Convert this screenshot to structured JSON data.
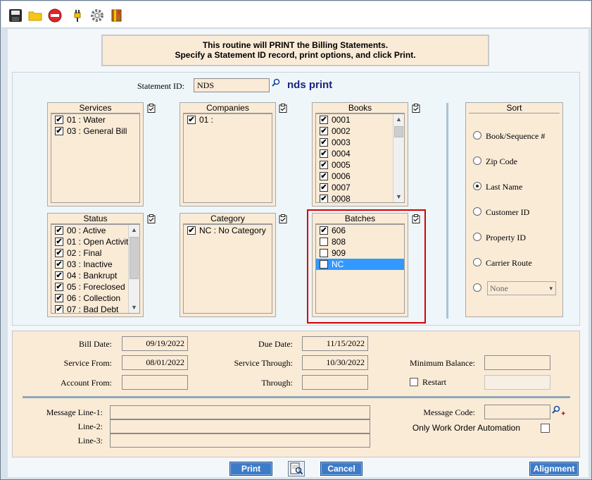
{
  "toolbar": {
    "icons": [
      "save-icon",
      "open-folder-icon",
      "stop-icon",
      "plug-icon",
      "gear-icon",
      "book-icon"
    ]
  },
  "banner": {
    "line1": "This routine will PRINT the Billing Statements.",
    "line2": "Specify a Statement ID record, print options, and click Print."
  },
  "statement": {
    "label": "Statement ID:",
    "value": "NDS",
    "name": "nds print"
  },
  "services": {
    "title": "Services",
    "items": [
      {
        "label": "01 : Water",
        "checked": "✔"
      },
      {
        "label": "03 : General Bill",
        "checked": "✔"
      }
    ]
  },
  "companies": {
    "title": "Companies",
    "items": [
      {
        "label": "01 :",
        "checked": "✔"
      }
    ]
  },
  "books": {
    "title": "Books",
    "items": [
      {
        "label": "0001",
        "checked": "✔"
      },
      {
        "label": "0002",
        "checked": "✔"
      },
      {
        "label": "0003",
        "checked": "✔"
      },
      {
        "label": "0004",
        "checked": "✔"
      },
      {
        "label": "0005",
        "checked": "✔"
      },
      {
        "label": "0006",
        "checked": "✔"
      },
      {
        "label": "0007",
        "checked": "✔"
      },
      {
        "label": "0008",
        "checked": "✔"
      }
    ]
  },
  "status": {
    "title": "Status",
    "items": [
      {
        "label": "00 : Active",
        "checked": "✔"
      },
      {
        "label": "01 : Open Activit",
        "checked": "✔"
      },
      {
        "label": "02 : Final",
        "checked": "✔"
      },
      {
        "label": "03 : Inactive",
        "checked": "✔"
      },
      {
        "label": "04 : Bankrupt",
        "checked": "✔"
      },
      {
        "label": "05 : Foreclosed",
        "checked": "✔"
      },
      {
        "label": "06 : Collection",
        "checked": "✔"
      },
      {
        "label": "07 : Bad Debt",
        "checked": "✔"
      }
    ]
  },
  "category": {
    "title": "Category",
    "items": [
      {
        "label": "NC : No Category",
        "checked": "✔"
      }
    ]
  },
  "batches": {
    "title": "Batches",
    "items": [
      {
        "label": "606",
        "checked": "✔"
      },
      {
        "label": "808",
        "checked": ""
      },
      {
        "label": "909",
        "checked": ""
      },
      {
        "label": "NC",
        "checked": ""
      }
    ],
    "selected_item": "NC"
  },
  "sort": {
    "title": "Sort",
    "options": [
      {
        "label": "Book/Sequence #",
        "selected": false
      },
      {
        "label": "Zip Code",
        "selected": false
      },
      {
        "label": "Last Name",
        "selected": true
      },
      {
        "label": "Customer ID",
        "selected": false
      },
      {
        "label": "Property ID",
        "selected": false
      },
      {
        "label": "Carrier Route",
        "selected": false
      }
    ],
    "dropdown_value": "None"
  },
  "dates": {
    "bill_date_label": "Bill Date:",
    "bill_date": "09/19/2022",
    "due_date_label": "Due Date:",
    "due_date": "11/15/2022",
    "service_from_label": "Service From:",
    "service_from": "08/01/2022",
    "service_through_label": "Service Through:",
    "service_through": "10/30/2022",
    "account_from_label": "Account From:",
    "account_from": "",
    "through_label": "Through:",
    "through": "",
    "min_balance_label": "Minimum Balance:",
    "min_balance": "",
    "restart_label": "Restart",
    "restart_value": ""
  },
  "messages": {
    "line1_label": "Message Line-1:",
    "line2_label": "Line-2:",
    "line3_label": "Line-3:",
    "line1": "",
    "line2": "",
    "line3": "",
    "code_label": "Message Code:",
    "code": "",
    "work_order_label": "Only Work Order Automation"
  },
  "buttons": {
    "print": "Print",
    "cancel": "Cancel",
    "alignment": "Alignment"
  }
}
